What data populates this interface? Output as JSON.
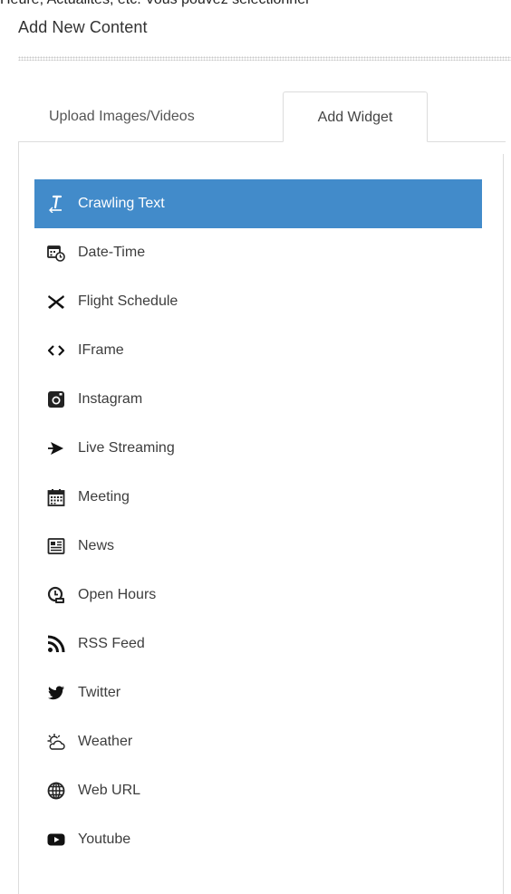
{
  "header": {
    "cut_text": "Heure, Actualités, etc. Vous pouvez sélectionner",
    "section_title": "Add New Content"
  },
  "tabs": [
    {
      "label": "Upload Images/Videos",
      "active": false
    },
    {
      "label": "Add Widget",
      "active": true
    }
  ],
  "widgets": [
    {
      "label": "Crawling Text",
      "icon": "text-cursor-icon",
      "selected": true
    },
    {
      "label": "Date-Time",
      "icon": "calendar-clock-icon",
      "selected": false
    },
    {
      "label": "Flight Schedule",
      "icon": "airplane-icon",
      "selected": false
    },
    {
      "label": "IFrame",
      "icon": "code-brackets-icon",
      "selected": false
    },
    {
      "label": "Instagram",
      "icon": "instagram-icon",
      "selected": false
    },
    {
      "label": "Live Streaming",
      "icon": "live-stream-icon",
      "selected": false
    },
    {
      "label": "Meeting",
      "icon": "calendar-icon",
      "selected": false
    },
    {
      "label": "News",
      "icon": "newspaper-icon",
      "selected": false
    },
    {
      "label": "Open Hours",
      "icon": "clock-icon",
      "selected": false
    },
    {
      "label": "RSS Feed",
      "icon": "rss-icon",
      "selected": false
    },
    {
      "label": "Twitter",
      "icon": "twitter-bird-icon",
      "selected": false
    },
    {
      "label": "Weather",
      "icon": "sun-cloud-icon",
      "selected": false
    },
    {
      "label": "Web URL",
      "icon": "globe-icon",
      "selected": false
    },
    {
      "label": "Youtube",
      "icon": "youtube-icon",
      "selected": false
    }
  ],
  "colors": {
    "active_background": "#428bca",
    "active_text": "#ffffff",
    "text": "#3d3d3d",
    "border": "#dcdcdc"
  }
}
